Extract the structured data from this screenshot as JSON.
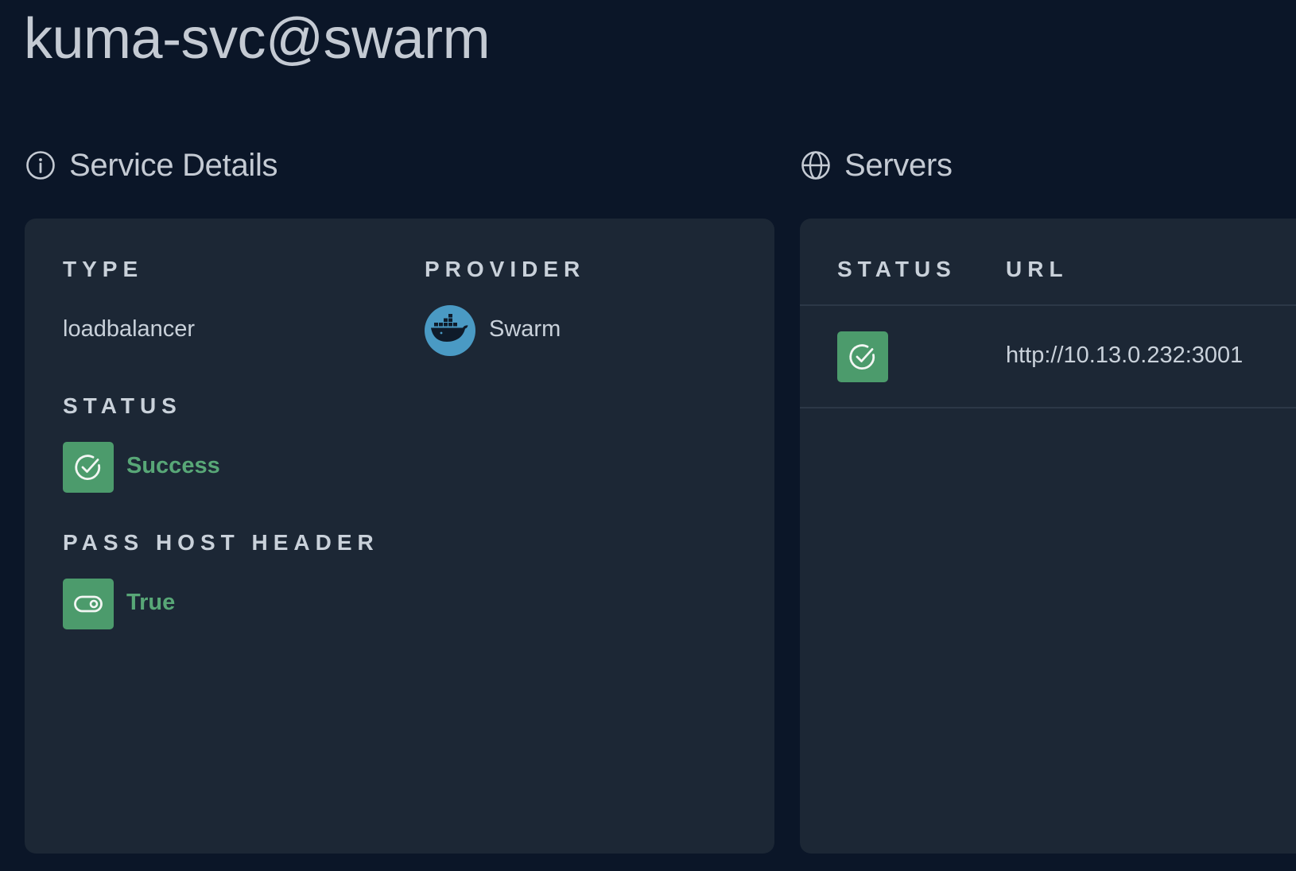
{
  "page": {
    "title": "kuma-svc@swarm"
  },
  "details": {
    "heading": "Service Details",
    "heading_icon": "info-icon",
    "type_label": "TYPE",
    "type_value": "loadbalancer",
    "provider_label": "PROVIDER",
    "provider_value": "Swarm",
    "provider_icon": "docker-icon",
    "status_label": "STATUS",
    "status_value": "Success",
    "status_icon": "check-circle-icon",
    "pass_host_label": "PASS HOST HEADER",
    "pass_host_value": "True",
    "pass_host_icon": "toggle-icon"
  },
  "servers": {
    "heading": "Servers",
    "heading_icon": "globe-icon",
    "columns": [
      "STATUS",
      "URL"
    ],
    "rows": [
      {
        "status_icon": "check-circle-icon",
        "url": "http://10.13.0.232:3001"
      }
    ]
  },
  "colors": {
    "background": "#0b1628",
    "card": "#1c2735",
    "success": "#4c9b6c",
    "success_text": "#58a777",
    "docker_blue": "#4a9ac4"
  }
}
